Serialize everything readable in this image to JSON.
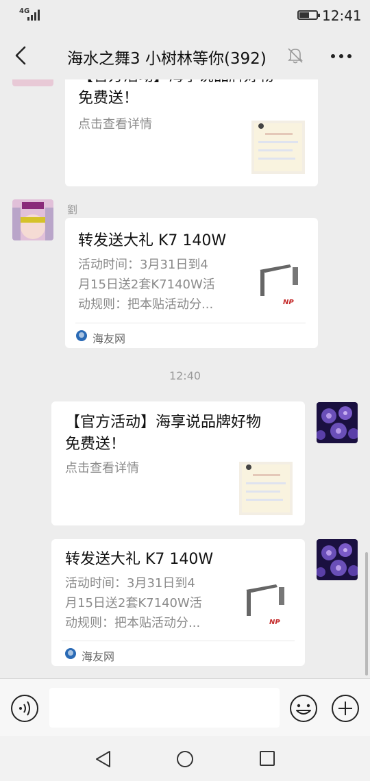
{
  "status_bar": {
    "signal": "4G",
    "time": "12:41"
  },
  "header": {
    "title": "海水之舞3 小树林等你(392)"
  },
  "messages": [
    {
      "sender": "",
      "title_line1": "【官方活动】海享说品牌好物",
      "title_line2": "免费送！",
      "desc": "点击查看详情"
    },
    {
      "sender": "劉",
      "title": "转发送大礼 K7 140W",
      "desc_line1": "活动时间：3月31日到4",
      "desc_line2": "月15日送2套K7140W活",
      "desc_line3": "动规则：把本贴活动分...",
      "source": "海友网"
    },
    {
      "timestamp": "12:40"
    },
    {
      "title_line1": "【官方活动】海享说品牌好物",
      "title_line2": "免费送！",
      "desc": "点击查看详情"
    },
    {
      "title": "转发送大礼 K7 140W",
      "desc_line1": "活动时间：3月31日到4",
      "desc_line2": "月15日送2套K7140W活",
      "desc_line3": "动规则：把本贴活动分...",
      "source": "海友网"
    }
  ],
  "input_bar": {
    "placeholder": ""
  },
  "icons": {
    "back": "chevron-left-icon",
    "mute": "bell-off-icon",
    "more": "more-icon",
    "voice": "voice-icon",
    "emoji": "emoji-icon",
    "plus": "plus-icon"
  },
  "colors": {
    "background": "#ededed",
    "bubble": "#ffffff",
    "source_icon": "#2a6ab5"
  }
}
